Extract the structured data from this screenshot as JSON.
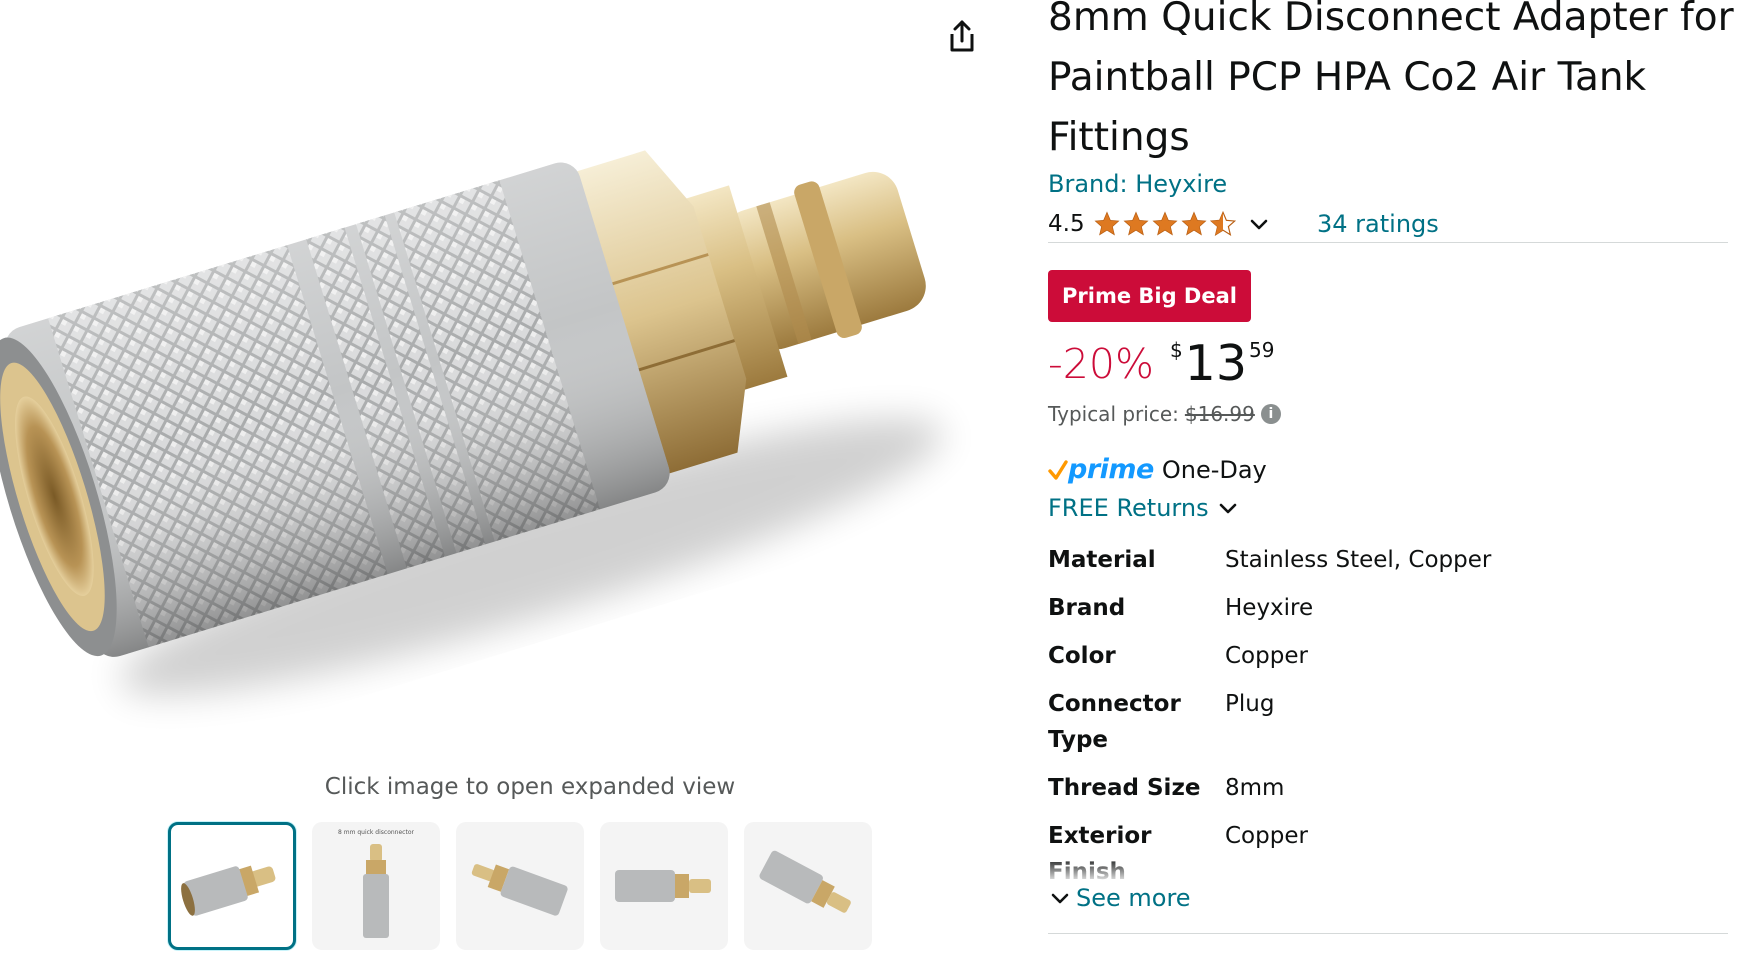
{
  "colors": {
    "link": "#007185",
    "deal_red": "#cc0c39",
    "star_orange": "#de7921",
    "prime_blue": "#1399ff",
    "prime_check": "#ff9900",
    "muted_text": "#565959"
  },
  "product": {
    "title": "8mm Quick Disconnect Adapter for Paintball PCP HPA Co2 Air Tank Fittings",
    "brand_label": "Brand: Heyxire"
  },
  "gallery": {
    "share_icon": "share-icon",
    "expand_hint": "Click image to open expanded view",
    "thumbnails": [
      {
        "label": "thumbnail 1",
        "selected": true
      },
      {
        "label": "thumbnail 2",
        "caption": "8 mm quick disconnector",
        "selected": false
      },
      {
        "label": "thumbnail 3",
        "selected": false
      },
      {
        "label": "thumbnail 4",
        "selected": false
      },
      {
        "label": "thumbnail 5",
        "selected": false
      }
    ]
  },
  "rating": {
    "value": "4.5",
    "stars": 4.5,
    "count_label": "34 ratings"
  },
  "pricing": {
    "deal_badge": "Prime Big Deal",
    "discount": "-20%",
    "currency_symbol": "$",
    "price_whole": "13",
    "price_fraction": "59",
    "typical_label": "Typical price:",
    "typical_price": "$16.99"
  },
  "delivery": {
    "prime_label": "prime",
    "speed": "One-Day",
    "returns_label": "FREE Returns"
  },
  "specs": {
    "rows": [
      {
        "key": "Material",
        "value": "Stainless Steel, Copper"
      },
      {
        "key": "Brand",
        "value": "Heyxire"
      },
      {
        "key": "Color",
        "value": "Copper"
      },
      {
        "key": "Connector Type",
        "value": "Plug"
      },
      {
        "key": "Thread Size",
        "value": "8mm"
      },
      {
        "key": "Exterior Finish",
        "value": "Copper"
      }
    ],
    "see_more_label": "See more"
  }
}
